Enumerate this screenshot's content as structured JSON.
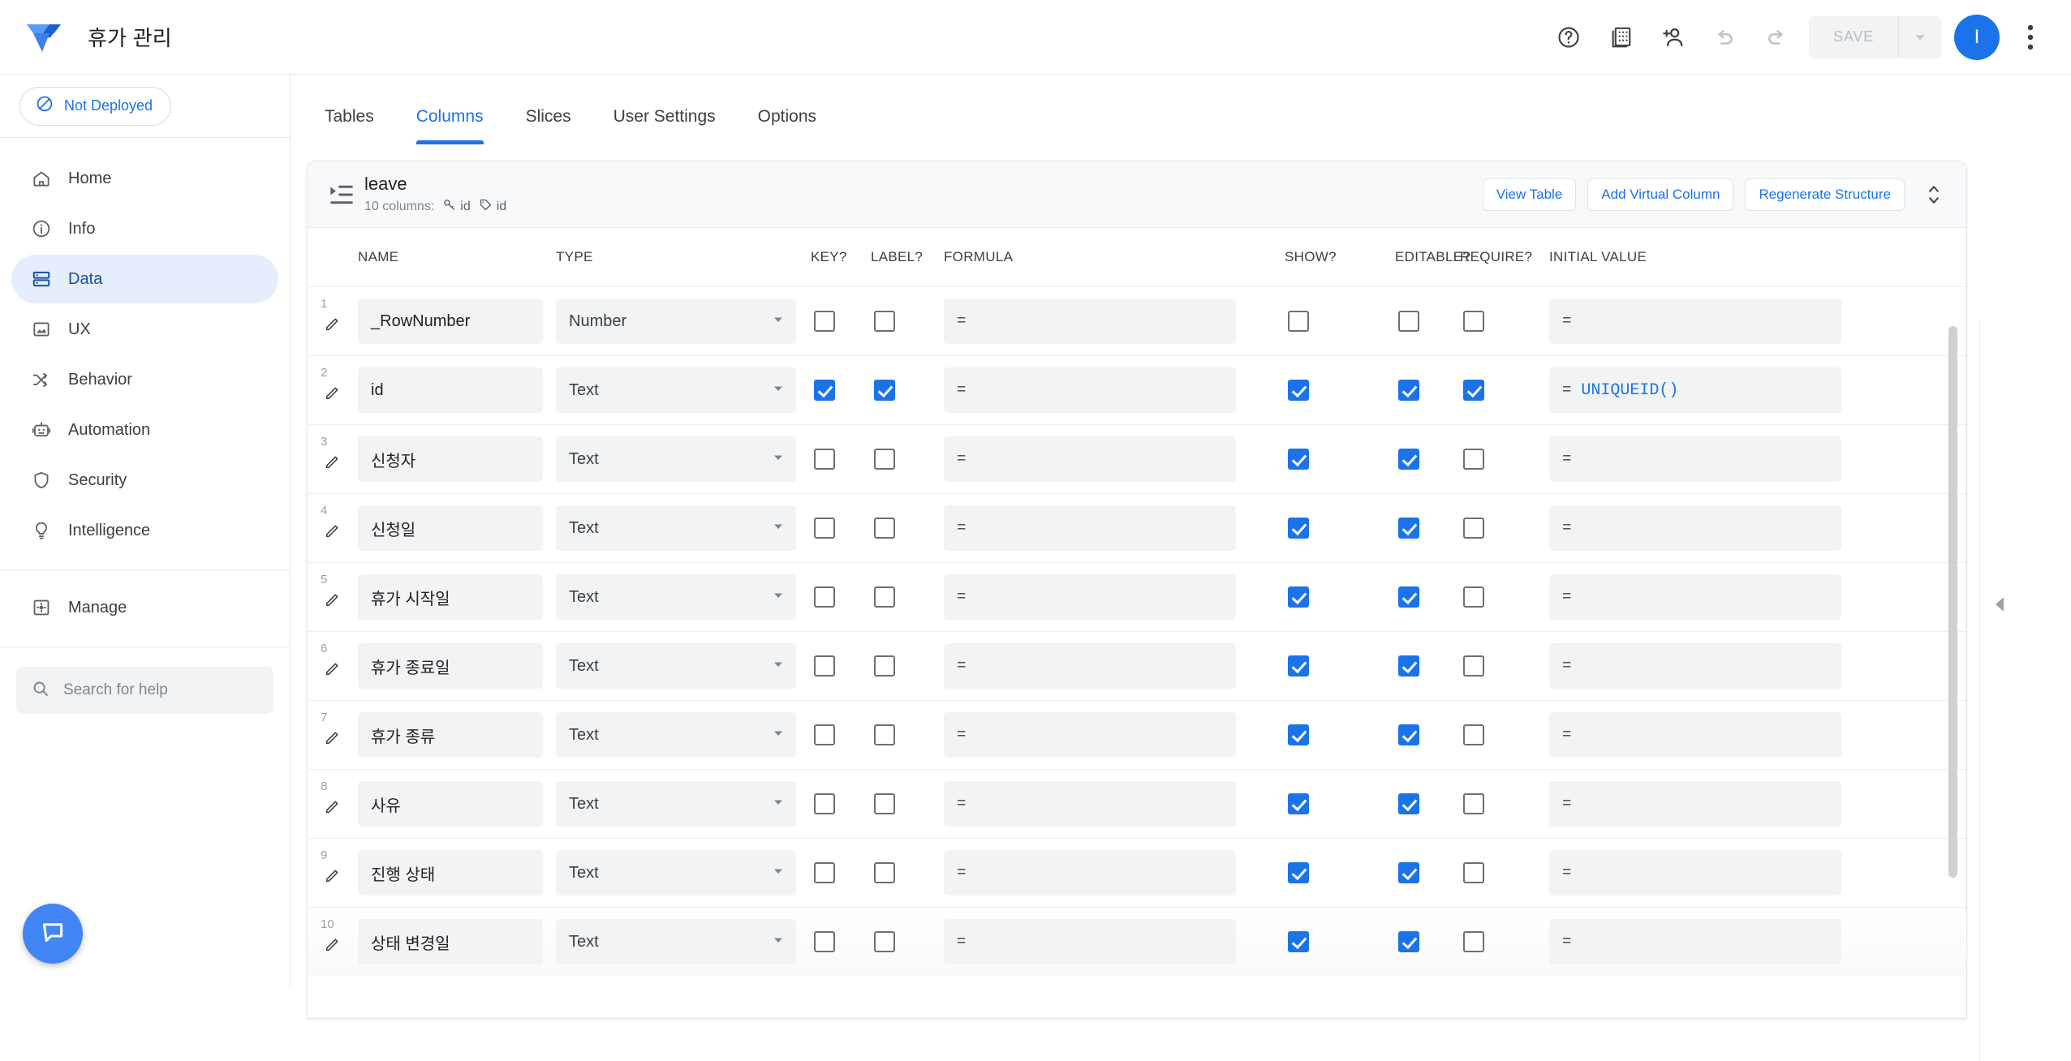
{
  "topbar": {
    "app_title": "휴가 관리",
    "logo_name": "appsheet-logo",
    "icons": [
      {
        "name": "help-icon",
        "label": "Help"
      },
      {
        "name": "data-source-icon",
        "label": "Data source"
      },
      {
        "name": "add-person-icon",
        "label": "Share app"
      },
      {
        "name": "undo-icon",
        "label": "Undo"
      },
      {
        "name": "redo-icon",
        "label": "Redo"
      }
    ],
    "save_label": "SAVE",
    "save_enabled": false,
    "avatar_initial": "I",
    "kebab_label": "More options"
  },
  "sidebar": {
    "deploy_status": "Not Deployed",
    "items": [
      {
        "label": "Home",
        "icon": "home-icon",
        "active": false
      },
      {
        "label": "Info",
        "icon": "info-icon",
        "active": false
      },
      {
        "label": "Data",
        "icon": "database-icon",
        "active": true
      },
      {
        "label": "UX",
        "icon": "image-icon",
        "active": false
      },
      {
        "label": "Behavior",
        "icon": "behavior-icon",
        "active": false
      },
      {
        "label": "Automation",
        "icon": "robot-icon",
        "active": false
      },
      {
        "label": "Security",
        "icon": "shield-icon",
        "active": false
      },
      {
        "label": "Intelligence",
        "icon": "lightbulb-icon",
        "active": false
      }
    ],
    "manage": {
      "label": "Manage",
      "icon": "gear-icon"
    },
    "search_placeholder": "Search for help",
    "chat_button": "chat-icon"
  },
  "tabs": [
    {
      "label": "Tables",
      "active": false
    },
    {
      "label": "Columns",
      "active": true
    },
    {
      "label": "Slices",
      "active": false
    },
    {
      "label": "User Settings",
      "active": false
    },
    {
      "label": "Options",
      "active": false
    }
  ],
  "table_card": {
    "table_name": "leave",
    "columns_count_label": "10 columns:",
    "key_chip": "id",
    "label_chip": "id",
    "actions": [
      {
        "label": "View Table",
        "name": "view-table-button"
      },
      {
        "label": "Add Virtual Column",
        "name": "add-virtual-column-button"
      },
      {
        "label": "Regenerate Structure",
        "name": "regenerate-structure-button"
      }
    ],
    "headers": [
      "NAME",
      "TYPE",
      "KEY?",
      "LABEL?",
      "FORMULA",
      "SHOW?",
      "EDITABLE?",
      "REQUIRE?",
      "INITIAL VALUE"
    ],
    "formula_prefix": "=",
    "rows": [
      {
        "num": "1",
        "name": "_RowNumber",
        "type": "Number",
        "key": false,
        "label": false,
        "formula": "",
        "show": false,
        "editable": false,
        "require": false,
        "initial": ""
      },
      {
        "num": "2",
        "name": "id",
        "type": "Text",
        "key": true,
        "label": true,
        "formula": "",
        "show": true,
        "editable": true,
        "require": true,
        "initial": "UNIQUEID()"
      },
      {
        "num": "3",
        "name": "신청자",
        "type": "Text",
        "key": false,
        "label": false,
        "formula": "",
        "show": true,
        "editable": true,
        "require": false,
        "initial": ""
      },
      {
        "num": "4",
        "name": "신청일",
        "type": "Text",
        "key": false,
        "label": false,
        "formula": "",
        "show": true,
        "editable": true,
        "require": false,
        "initial": ""
      },
      {
        "num": "5",
        "name": "휴가 시작일",
        "type": "Text",
        "key": false,
        "label": false,
        "formula": "",
        "show": true,
        "editable": true,
        "require": false,
        "initial": ""
      },
      {
        "num": "6",
        "name": "휴가 종료일",
        "type": "Text",
        "key": false,
        "label": false,
        "formula": "",
        "show": true,
        "editable": true,
        "require": false,
        "initial": ""
      },
      {
        "num": "7",
        "name": "휴가 종류",
        "type": "Text",
        "key": false,
        "label": false,
        "formula": "",
        "show": true,
        "editable": true,
        "require": false,
        "initial": ""
      },
      {
        "num": "8",
        "name": "사유",
        "type": "Text",
        "key": false,
        "label": false,
        "formula": "",
        "show": true,
        "editable": true,
        "require": false,
        "initial": ""
      },
      {
        "num": "9",
        "name": "진행 상태",
        "type": "Text",
        "key": false,
        "label": false,
        "formula": "",
        "show": true,
        "editable": true,
        "require": false,
        "initial": ""
      },
      {
        "num": "10",
        "name": "상태 변경일",
        "type": "Text",
        "key": false,
        "label": false,
        "formula": "",
        "show": true,
        "editable": true,
        "require": false,
        "initial": ""
      }
    ]
  },
  "colors": {
    "accent": "#1a73e8",
    "active_pill_bg": "#e6edfd",
    "active_pill_text": "#174ea6",
    "field_bg": "#f1f3f4",
    "card_head_bg": "#f7f9fa"
  }
}
